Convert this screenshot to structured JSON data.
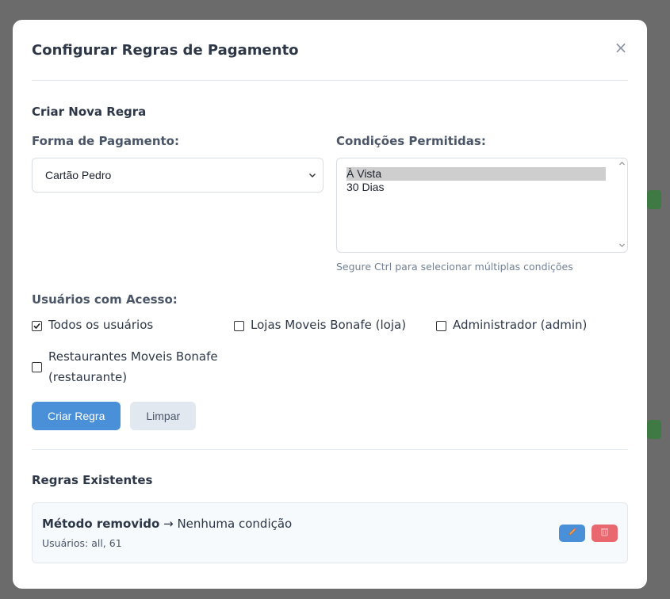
{
  "modal": {
    "title": "Configurar Regras de Pagamento",
    "close_glyph": "×"
  },
  "new_rule": {
    "section_title": "Criar Nova Regra",
    "payment_label": "Forma de Pagamento:",
    "payment_selected": "Cartão Pedro",
    "conditions_label": "Condições Permitidas:",
    "conditions_options": [
      {
        "label": "À Vista",
        "selected": true
      },
      {
        "label": "30 Dias",
        "selected": false
      }
    ],
    "conditions_hint": "Segure Ctrl para selecionar múltiplas condições",
    "users_label": "Usuários com Acesso:",
    "users": [
      {
        "label": "Todos os usuários",
        "checked": true
      },
      {
        "label": "Lojas Moveis Bonafe (loja)",
        "checked": false
      },
      {
        "label": "Administrador (admin)",
        "checked": false
      },
      {
        "label": "Restaurantes Moveis Bonafe (restaurante)",
        "checked": false
      }
    ],
    "create_button": "Criar Regra",
    "clear_button": "Limpar"
  },
  "existing": {
    "section_title": "Regras Existentes",
    "rules": [
      {
        "method": "Método removido",
        "arrow": "→",
        "conditions": "Nenhuma condição",
        "users": "Usuários: all, 61"
      }
    ]
  },
  "icons": {
    "edit": "pencil-icon",
    "delete": "trash-icon"
  },
  "colors": {
    "primary": "#4a90d9",
    "edit_button": "#4a90d9",
    "delete_button": "#e9676f"
  }
}
